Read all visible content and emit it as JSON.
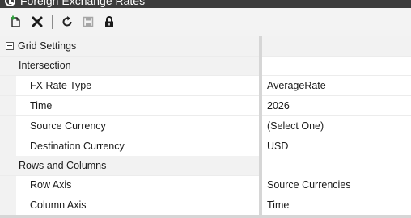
{
  "window": {
    "title": "Foreign Exchange Rates"
  },
  "toolbar": {
    "buttons": [
      {
        "name": "new",
        "icon": "new-document-icon",
        "enabled": true
      },
      {
        "name": "delete",
        "icon": "close-x-icon",
        "enabled": true
      },
      {
        "name": "refresh",
        "icon": "refresh-icon",
        "enabled": true
      },
      {
        "name": "save",
        "icon": "save-disk-icon",
        "enabled": false
      },
      {
        "name": "lock",
        "icon": "padlock-icon",
        "enabled": true
      }
    ]
  },
  "grid": {
    "section_title": "Grid Settings",
    "intersection": {
      "label": "Intersection",
      "properties": [
        {
          "name": "FX Rate Type",
          "value": "AverageRate"
        },
        {
          "name": "Time",
          "value": "2026"
        },
        {
          "name": "Source Currency",
          "value": "(Select One)"
        },
        {
          "name": "Destination Currency",
          "value": "USD"
        }
      ]
    },
    "rows_and_columns": {
      "label": "Rows and Columns",
      "properties": [
        {
          "name": "Row Axis",
          "value": "Source Currencies"
        },
        {
          "name": "Column Axis",
          "value": "Time"
        }
      ]
    }
  },
  "colors": {
    "titlebar_bg": "#3c3c3c",
    "toolbar_bg": "#f3f3f3",
    "new_icon_accent": "#2e9e3a",
    "category_bg": "#f2f2f2",
    "divider": "#d6d6d6"
  }
}
